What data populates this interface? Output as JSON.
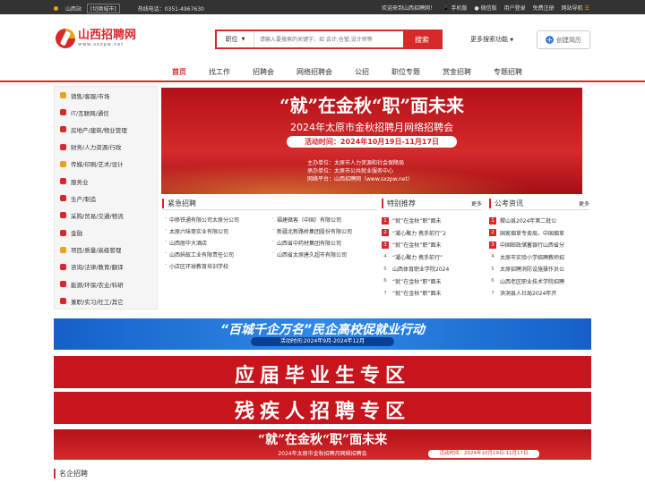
{
  "topbar": {
    "city": "山西站",
    "switch": "[切换城市]",
    "hotline": "热线电话：0351-4967630",
    "welcome": "欢迎来到山西招聘网！",
    "mobile": "手机版",
    "wechat": "微信版",
    "login": "用户登录",
    "register": "免费注册",
    "nav": "网站导航"
  },
  "logo": {
    "name": "山西招聘网",
    "url": "www.sxzpw.net"
  },
  "search": {
    "category": "职位",
    "placeholder": "请输入要搜索的关键字，如 会计,仓管,设计师等",
    "button": "搜索",
    "more": "更多搜索功能"
  },
  "create_resume": "创建简历",
  "nav": [
    "首页",
    "找工作",
    "招聘会",
    "网络招聘会",
    "公招",
    "职位专题",
    "赏金招聘",
    "专题招聘"
  ],
  "sidebar": [
    {
      "label": "销售/客服/市场",
      "color": "#e8a317"
    },
    {
      "label": "IT/互联网/通信",
      "color": "#d7282a"
    },
    {
      "label": "房地产/建筑/物业管理",
      "color": "#d7282a"
    },
    {
      "label": "财务/人力资源/行政",
      "color": "#d7282a"
    },
    {
      "label": "传媒/印刷/艺术/设计",
      "color": "#e8a317"
    },
    {
      "label": "服务业",
      "color": "#d7282a"
    },
    {
      "label": "生产/制造",
      "color": "#d7282a"
    },
    {
      "label": "采购/贸易/交通/物流",
      "color": "#d7282a"
    },
    {
      "label": "金融",
      "color": "#d7282a"
    },
    {
      "label": "项目/质量/高级管理",
      "color": "#e8a317"
    },
    {
      "label": "咨询/法律/教育/翻译",
      "color": "#d7282a"
    },
    {
      "label": "能源/环保/农业/科研",
      "color": "#d7282a"
    },
    {
      "label": "兼职/实习/社工/其它",
      "color": "#d7282a"
    }
  ],
  "banner": {
    "headline": "“就”在金秋“职”面未来",
    "subtitle": "2024年太原市金秋招聘月网络招聘会",
    "time": "活动时间：2024年10月19日-11月17日",
    "host": "主办单位：太原市人力资源和社会保障局",
    "organizer": "承办单位：太原市公共就业服务中心",
    "platform": "网络平台：山西招聘网（www.sxzpw.net）"
  },
  "urgent": {
    "title": "紧急招聘",
    "items": [
      "中移铁通有限公司太原分公司",
      "福建赣客（中国）有限公司",
      "太原六味斋实业有限公司",
      "新疆北新路桥集团股份有限公司",
      "山西丽华大酒店",
      "山西省中药材集团有限公司",
      "山西蚂蚁工业有限责任公司",
      "山西省太原唐久超市有限公司",
      "小店区环球教育培训学校",
      ""
    ]
  },
  "special": {
    "title": "特别推荐",
    "more": "更多",
    "items": [
      "“就”在金秋“职”面未",
      "“凝心聚力 携手前行”2",
      "“就”在金秋“职”面未",
      "“凝心聚力 携手前行”",
      "山西体育职业学院2024",
      "“就”在金秋“职”面未",
      "“就”在金秋“职”面未"
    ]
  },
  "exam": {
    "title": "公考资讯",
    "more": "更多",
    "items": [
      "稷山县2024年第二批公",
      "国家烟草专卖局、中国烟草",
      "中国邮政储蓄银行山西省分",
      "太原市实验小学临聘教师招",
      "太原招聘消防设施操作员公",
      "山西老区职业技术学院招聘",
      "洪洞县人社局2024年开"
    ]
  },
  "ban1": {
    "title": "“百城千企万名”民企高校促就业行动",
    "time": "活动时间:2024年9月-2024年12月"
  },
  "ban2": "应届毕业生专区",
  "ban3": "残疾人招聘专区",
  "ban4": {
    "title": "“就”在金秋“职”面未来",
    "subtitle": "2024年太原市金秋招聘月网络招聘会",
    "time": "活动时间：2024年10月19日-11月17日"
  },
  "famous": "名企招聘"
}
